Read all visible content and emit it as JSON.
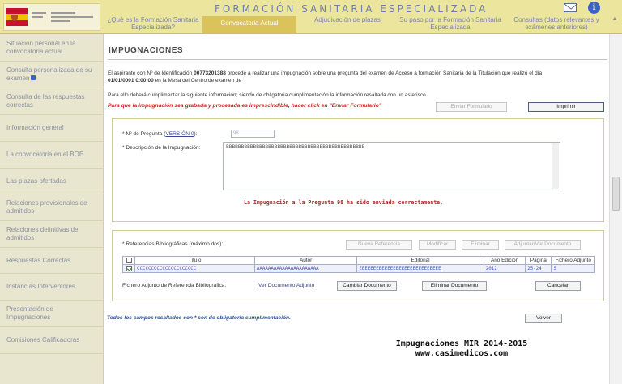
{
  "header": {
    "app_title": "FORMACIÓN SANITARIA ESPECIALIZADA",
    "logo_text": "GOBIERNO DE ESPAÑA · MINISTERIO DE SANIDAD, SERVICIOS SOCIALES E IGUALDAD",
    "tabs": [
      {
        "label": "¿Qué es la Formación Sanitaria Especializada?",
        "active": false
      },
      {
        "label": "Convocatoria Actual",
        "active": true
      },
      {
        "label": "Adjudicación de plazas",
        "active": false
      },
      {
        "label": "Su paso por la Formación Sanitaria Especializada",
        "active": false
      },
      {
        "label": "Consultas (datos relevantes y exámenes anteriores)",
        "active": false
      }
    ],
    "icons": [
      "mail-icon",
      "info-icon"
    ]
  },
  "sidebar": {
    "items": [
      {
        "label": "Situación personal en la convocatoria actual"
      },
      {
        "label": "Consulta personalizada de su examen"
      },
      {
        "label": "Consulta de las respuestas correctas"
      },
      {
        "label": "Información general"
      },
      {
        "label": "La convocatoria en el BOE"
      },
      {
        "label": "Las plazas ofertadas"
      },
      {
        "label": "Relaciones provisionales de admitidos"
      },
      {
        "label": "Relaciones definitivas de admitidos"
      },
      {
        "label": "Respuestas Correctas"
      },
      {
        "label": "Instancias Interventores"
      },
      {
        "label": "Presentación de Impugnaciones"
      },
      {
        "label": "Comisiones Calificadoras"
      }
    ]
  },
  "main": {
    "title": "IMPUGNACIONES",
    "intro_1a": "El aspirante con Nº de Identificación",
    "id_number": "00773201388",
    "intro_1b": "procede a realizar una impugnación sobre una pregunta del examen de Acceso a formación Sanitaria de la Titulación que realizó el día",
    "exam_date": "01/01/0001 0:00:00",
    "intro_2": "en la Mesa del Centro de examen de",
    "instruction": "Para ello deberá cumplimentar la siguiente información; siendo de obligatoria cumplimentación la información resaltada con un asterisco.",
    "notice": "Para que la impugnación sea grabada y procesada es imprescindible, hacer click en \"Enviar Formulario\"",
    "send_button": "Enviar Formulario",
    "print_button": "Imprimir",
    "question_label_prefix": "* Nº de Pregunta (",
    "question_label_version": "VERSIÓN 0",
    "question_label_suffix": "):",
    "question_value": "98",
    "description_label": "* Descripción de la Impugnación:",
    "description_value": "BBBBBBBBBBBBBBBBBBBBBBBBBBBBBBBBBBBBBBBBBBBBBB",
    "success_message": "La Impugnación a la Pregunta 98 ha sido enviada correctamente.",
    "refs_label": "* Referencias Bibliográficas (máximo dos):",
    "ref_buttons": [
      "Nueva Referencia",
      "Modificar",
      "Eliminar",
      "Adjuntar/Ver Documento"
    ],
    "table": {
      "headers": [
        "",
        "Título",
        "Autor",
        "Editorial",
        "Año Edición",
        "Página",
        "Fichero Adjunto"
      ],
      "rows": [
        {
          "checked": true,
          "titulo": "CCCCCCCCCCCCCCCCCCCCC",
          "autor": "AAAAAAAAAAAAAAAAAAAAAA",
          "editorial": "EEEEEEEEEEEEEEEEEEEEEEEEEEEEE",
          "anio": "2012",
          "pagina": "25-24",
          "fichero": "S"
        }
      ]
    },
    "attach_label": "Fichero Adjunto de Referencia Bibliográfica:",
    "view_document": "Ver Documento Adjunto",
    "change_document": "Cambiar Documento",
    "delete_document": "Eliminar Documento",
    "cancel_button": "Cancelar",
    "footnote": "Todos los campos resaltados con * son de obligatoria cumplimentación.",
    "back_button": "Volver",
    "watermark_line1": "Impugnaciones MIR 2014-2015",
    "watermark_line2": "www.casimedicos.com"
  }
}
